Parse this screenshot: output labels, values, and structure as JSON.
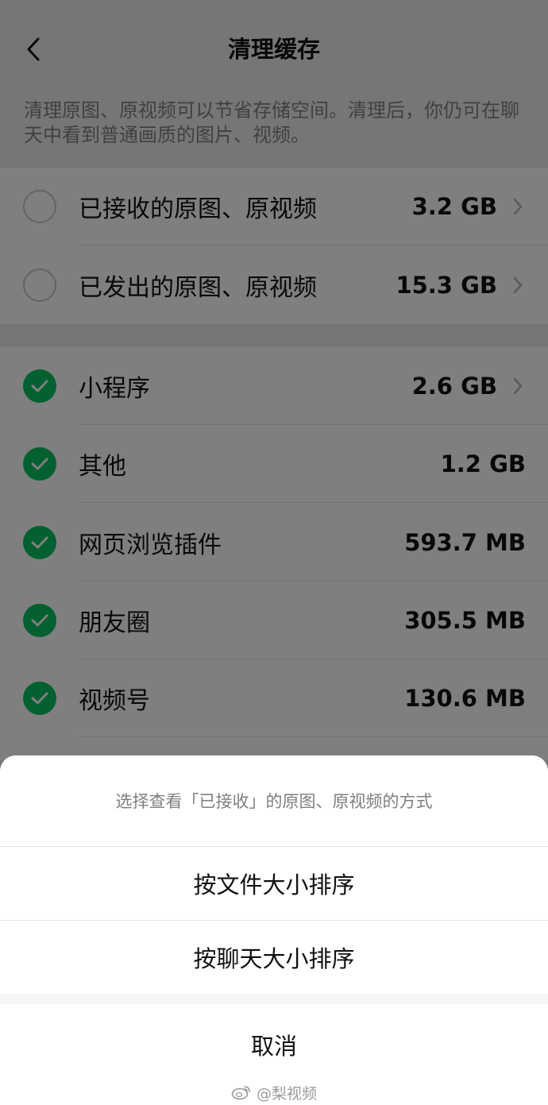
{
  "nav": {
    "title": "清理缓存"
  },
  "description": "清理原图、原视频可以节省存储空间。清理后，你仍可在聊天中看到普通画质的图片、视频。",
  "group1": [
    {
      "label": "已接收的原图、原视频",
      "size": "3.2 GB",
      "checked": false,
      "has_arrow": true
    },
    {
      "label": "已发出的原图、原视频",
      "size": "15.3 GB",
      "checked": false,
      "has_arrow": true
    }
  ],
  "group2": [
    {
      "label": "小程序",
      "size": "2.6 GB",
      "checked": true,
      "has_arrow": true
    },
    {
      "label": "其他",
      "size": "1.2 GB",
      "checked": true,
      "has_arrow": false
    },
    {
      "label": "网页浏览插件",
      "size": "593.7 MB",
      "checked": true,
      "has_arrow": false
    },
    {
      "label": "朋友圈",
      "size": "305.5 MB",
      "checked": true,
      "has_arrow": false
    },
    {
      "label": "视频号",
      "size": "130.6 MB",
      "checked": true,
      "has_arrow": false
    }
  ],
  "sheet": {
    "title": "选择查看「已接收」的原图、原视频的方式",
    "option_1": "按文件大小排序",
    "option_2": "按聊天大小排序",
    "cancel": "取消"
  },
  "watermark": "@梨视频",
  "colors": {
    "accent": "#07c160",
    "background": "#ededed",
    "overlay": "rgba(0,0,0,0.5)"
  }
}
